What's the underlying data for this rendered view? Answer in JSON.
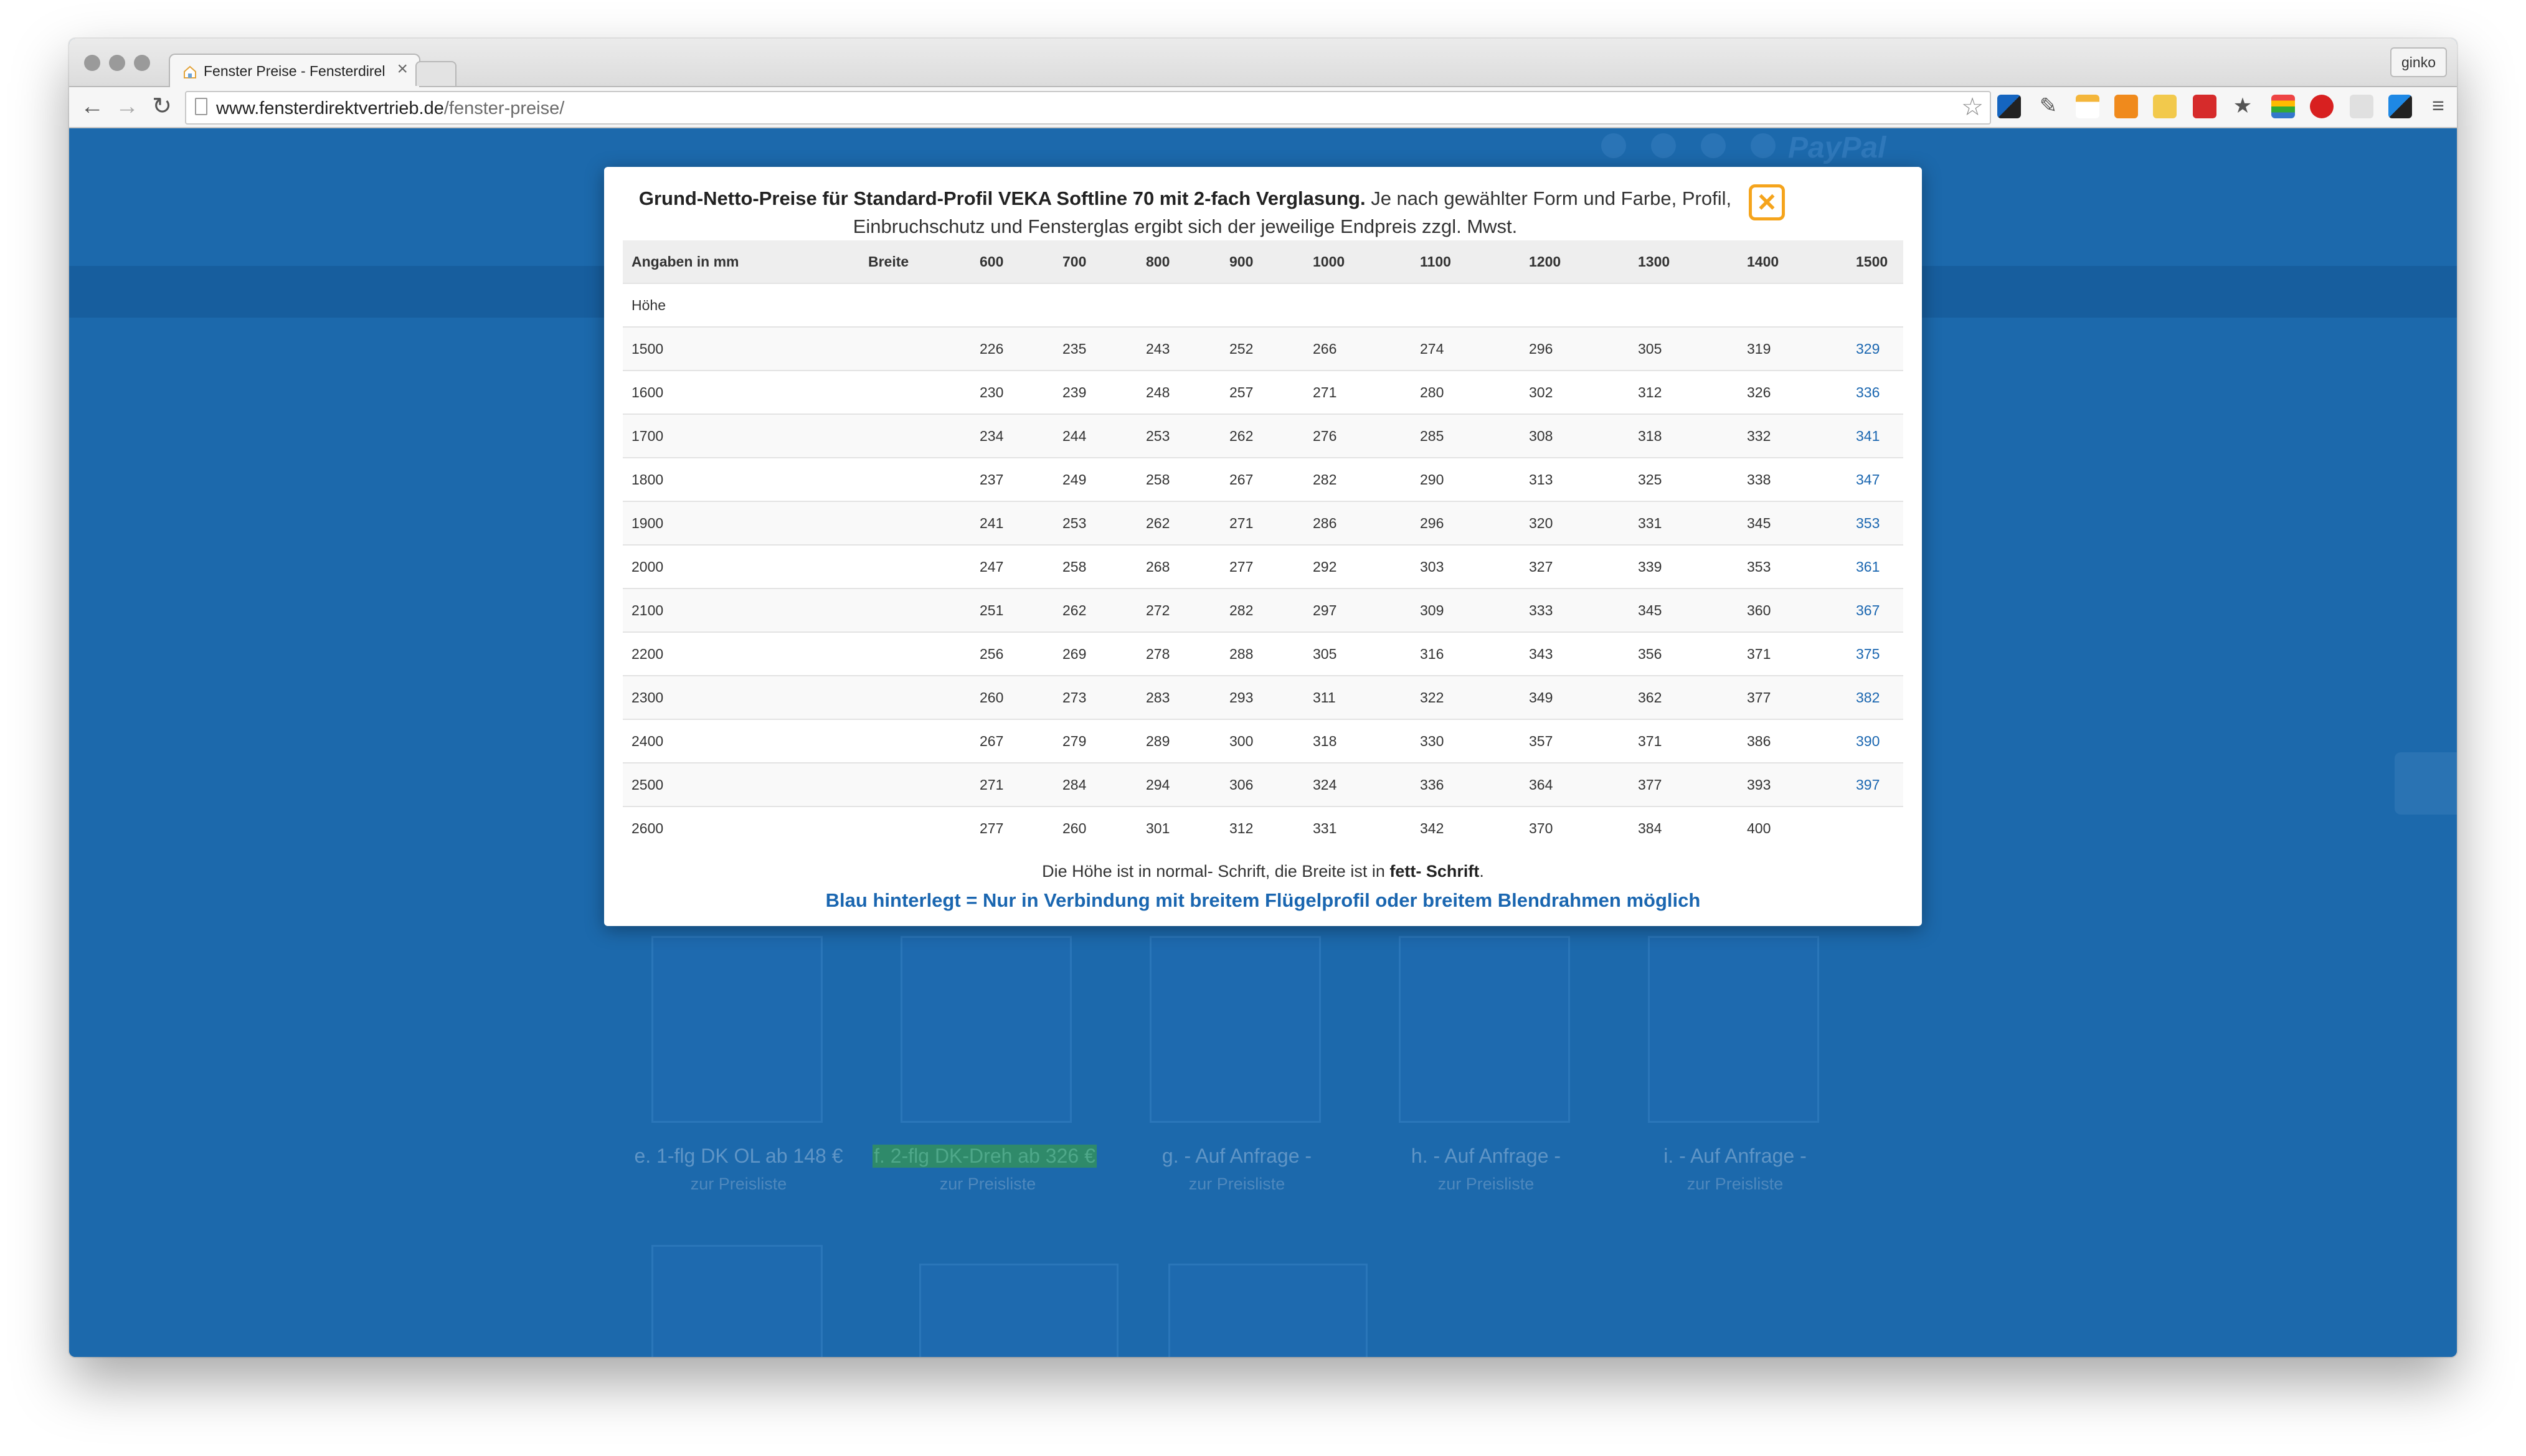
{
  "browser": {
    "tab_title": "Fenster Preise - Fensterdirektvertrieb",
    "tab_close": "×",
    "profile": "ginko",
    "url_host": "www.fensterdirektvertrieb.de",
    "url_path": "/fenster-preise/",
    "nav": {
      "back": "←",
      "forward": "→",
      "reload": "↻",
      "bookmark": "☆",
      "menu": "≡"
    }
  },
  "background_page": {
    "brand": "PayPal",
    "cards": [
      {
        "label": "e. 1-flg DK OL ab 148 €",
        "link": "zur Preisliste"
      },
      {
        "label": "f. 2-flg DK-Dreh ab 326 €",
        "link": "zur Preisliste"
      },
      {
        "label": "g. - Auf Anfrage -",
        "link": "zur Preisliste"
      },
      {
        "label": "h. - Auf Anfrage -",
        "link": "zur Preisliste"
      },
      {
        "label": "i. - Auf Anfrage -",
        "link": "zur Preisliste"
      }
    ]
  },
  "modal": {
    "close_label": "×",
    "heading_bold": "Grund-Netto-Preise für Standard-Profil VEKA Softline 70 mit 2-fach Verglasung.",
    "heading_text": "Je nach gewählter Form und Farbe, Profil, Einbruchschutz und Fensterglas ergibt sich der jeweilige Endpreis zzgl. Mwst.",
    "table": {
      "corner_label": "Angaben in mm",
      "width_label": "Breite",
      "height_label": "Höhe",
      "columns": [
        "600",
        "700",
        "800",
        "900",
        "1000",
        "1100",
        "1200",
        "1300",
        "1400",
        "1500"
      ],
      "rows": [
        {
          "h": "1500",
          "v": [
            "226",
            "235",
            "243",
            "252",
            "266",
            "274",
            "296",
            "305",
            "319",
            "329"
          ]
        },
        {
          "h": "1600",
          "v": [
            "230",
            "239",
            "248",
            "257",
            "271",
            "280",
            "302",
            "312",
            "326",
            "336"
          ]
        },
        {
          "h": "1700",
          "v": [
            "234",
            "244",
            "253",
            "262",
            "276",
            "285",
            "308",
            "318",
            "332",
            "341"
          ]
        },
        {
          "h": "1800",
          "v": [
            "237",
            "249",
            "258",
            "267",
            "282",
            "290",
            "313",
            "325",
            "338",
            "347"
          ]
        },
        {
          "h": "1900",
          "v": [
            "241",
            "253",
            "262",
            "271",
            "286",
            "296",
            "320",
            "331",
            "345",
            "353"
          ]
        },
        {
          "h": "2000",
          "v": [
            "247",
            "258",
            "268",
            "277",
            "292",
            "303",
            "327",
            "339",
            "353",
            "361"
          ]
        },
        {
          "h": "2100",
          "v": [
            "251",
            "262",
            "272",
            "282",
            "297",
            "309",
            "333",
            "345",
            "360",
            "367"
          ]
        },
        {
          "h": "2200",
          "v": [
            "256",
            "269",
            "278",
            "288",
            "305",
            "316",
            "343",
            "356",
            "371",
            "375"
          ]
        },
        {
          "h": "2300",
          "v": [
            "260",
            "273",
            "283",
            "293",
            "311",
            "322",
            "349",
            "362",
            "377",
            "382"
          ]
        },
        {
          "h": "2400",
          "v": [
            "267",
            "279",
            "289",
            "300",
            "318",
            "330",
            "357",
            "371",
            "386",
            "390"
          ]
        },
        {
          "h": "2500",
          "v": [
            "271",
            "284",
            "294",
            "306",
            "324",
            "336",
            "364",
            "377",
            "393",
            "397"
          ]
        },
        {
          "h": "2600",
          "v": [
            "277",
            "260",
            "301",
            "312",
            "331",
            "342",
            "370",
            "384",
            "400",
            ""
          ]
        }
      ]
    },
    "note_prefix": "Die Höhe ist in normal- Schrift, die Breite ist in ",
    "note_bold": "fett- Schrift",
    "note_suffix": ".",
    "blue_note": "Blau hinterlegt = Nur in Verbindung mit breitem Flügelprofil oder breitem Blendrahmen möglich"
  },
  "colors": {
    "page_blue": "#1c69ac",
    "link_blue": "#1a66b0",
    "close_orange": "#f5a41c"
  }
}
